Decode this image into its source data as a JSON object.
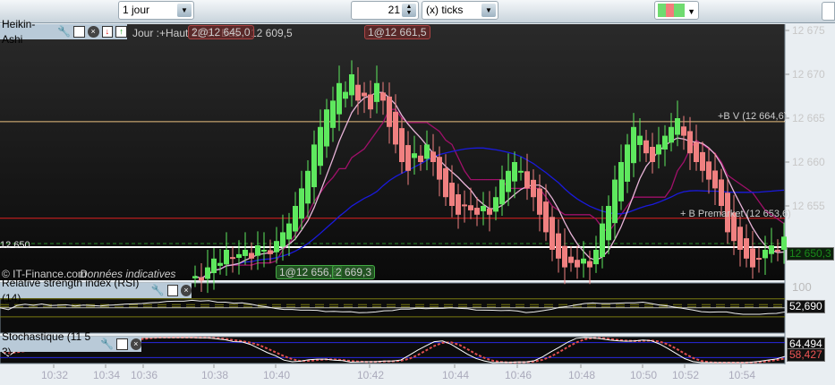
{
  "toolbar": {
    "period": "1 jour",
    "ticks_value": "21",
    "ticks_unit": "(x) ticks",
    "chart_type_icon": "indicator-chart-icon"
  },
  "main_panel": {
    "title": "Heikin-Ashi",
    "day_info": "Jour :+Haut 12 6.. Bas",
    "day_low": "12 609,5",
    "order_label_1": "2@12 645,0",
    "order_label_2": "1@12 661,5",
    "order_label_3": "1@12 656,8",
    "order_label_4": "2 669,3",
    "line_bv": "+B V (12 664,6)",
    "line_premarket": "+ B Premarket (12 653,6)",
    "left_level": "12 650",
    "copyright": "© IT-Finance.com",
    "disclaimer": "Données indicatives",
    "last_price": "12 650,3",
    "price_ticks": [
      "12 675",
      "12 670",
      "12 665",
      "12 660",
      "12 655"
    ]
  },
  "rsi_panel": {
    "title": "Relative strength index (RSI) (14)",
    "value": "52,690",
    "axis_top": "100"
  },
  "stoch_panel": {
    "title": "Stochastique (11 5 3)",
    "k_value": "64,494",
    "d_value": "58,427"
  },
  "time_axis": [
    "10:32",
    "10:34",
    "10:36",
    "10:38",
    "10:40",
    "10:42",
    "10:44",
    "10:46",
    "10:48",
    "10:50",
    "10:52",
    "10:54"
  ],
  "colors": {
    "up": "#5ee85e",
    "down": "#f08080",
    "bg": "#131313",
    "sma_fast": "#e8b4d8",
    "sma_slow": "#1a1adc",
    "step": "#a0106a"
  },
  "chart_data": {
    "type": "candlestick",
    "ylim": [
      12645,
      12676
    ],
    "closes": [
      12647,
      12646.5,
      12648,
      12649,
      12648.5,
      12650,
      12649,
      12649.5,
      12650,
      12649,
      12650.5,
      12650,
      12649.5,
      12651,
      12652,
      12653,
      12655,
      12657,
      12659,
      12662,
      12664,
      12666,
      12667,
      12669,
      12668,
      12670,
      12667,
      12667.5,
      12666,
      12669,
      12667,
      12664,
      12662,
      12660,
      12659,
      12661,
      12660,
      12662,
      12660,
      12658,
      12656,
      12655,
      12654,
      12655,
      12654.5,
      12654,
      12655,
      12654,
      12656,
      12658,
      12659,
      12660,
      12659,
      12657,
      12656,
      12654,
      12652,
      12650,
      12649,
      12648,
      12648.5,
      12648,
      12649,
      12648,
      12650,
      12653,
      12655,
      12658,
      12660,
      12662,
      12664,
      12663,
      12661,
      12660,
      12662,
      12663,
      12664,
      12665,
      12663,
      12661,
      12660,
      12659,
      12658,
      12657,
      12655,
      12652,
      12651,
      12650,
      12649,
      12648,
      12649,
      12650,
      12650.5,
      12650,
      12651.5
    ],
    "levels": {
      "bv": 12664.6,
      "premarket": 12653.6,
      "last": 12650.3
    }
  }
}
